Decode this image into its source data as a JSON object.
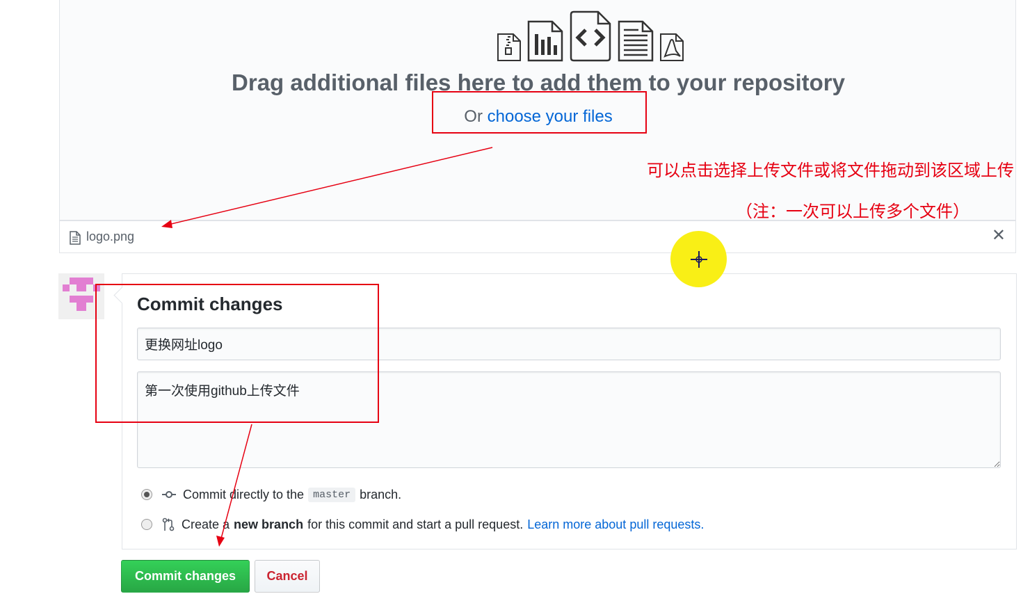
{
  "dropzone": {
    "file_type_icons": [
      "zip-file-icon",
      "chart-file-icon",
      "code-file-icon",
      "text-file-icon",
      "pdf-file-icon"
    ],
    "title": "Drag additional files here to add them to your repository",
    "choose_prefix": "Or",
    "choose_link": "choose your files"
  },
  "uploaded_file": {
    "icon": "file-icon",
    "name": "logo.png",
    "remove_glyph": "✕"
  },
  "commit": {
    "title": "Commit changes",
    "summary_value": "更换网址logo",
    "description_value": "第一次使用github上传文件",
    "option_direct": {
      "selected": true,
      "before": "Commit directly to the",
      "branch": "master",
      "after": "branch."
    },
    "option_new_branch": {
      "selected": false,
      "before": "Create a",
      "bold": "new branch",
      "after": "for this commit and start a pull request.",
      "link": "Learn more about pull requests."
    }
  },
  "buttons": {
    "commit": "Commit changes",
    "cancel": "Cancel"
  },
  "annotation": {
    "text": "可以点击选择上传文件或将文件拖动到该区域上传",
    "note": "（注：一次可以上传多个文件）",
    "color": "#e60012"
  },
  "colors": {
    "link": "#0366d6",
    "primary_button": "#28a745",
    "cancel_text": "#cb2431",
    "cursor_highlight": "#f9ef16"
  }
}
